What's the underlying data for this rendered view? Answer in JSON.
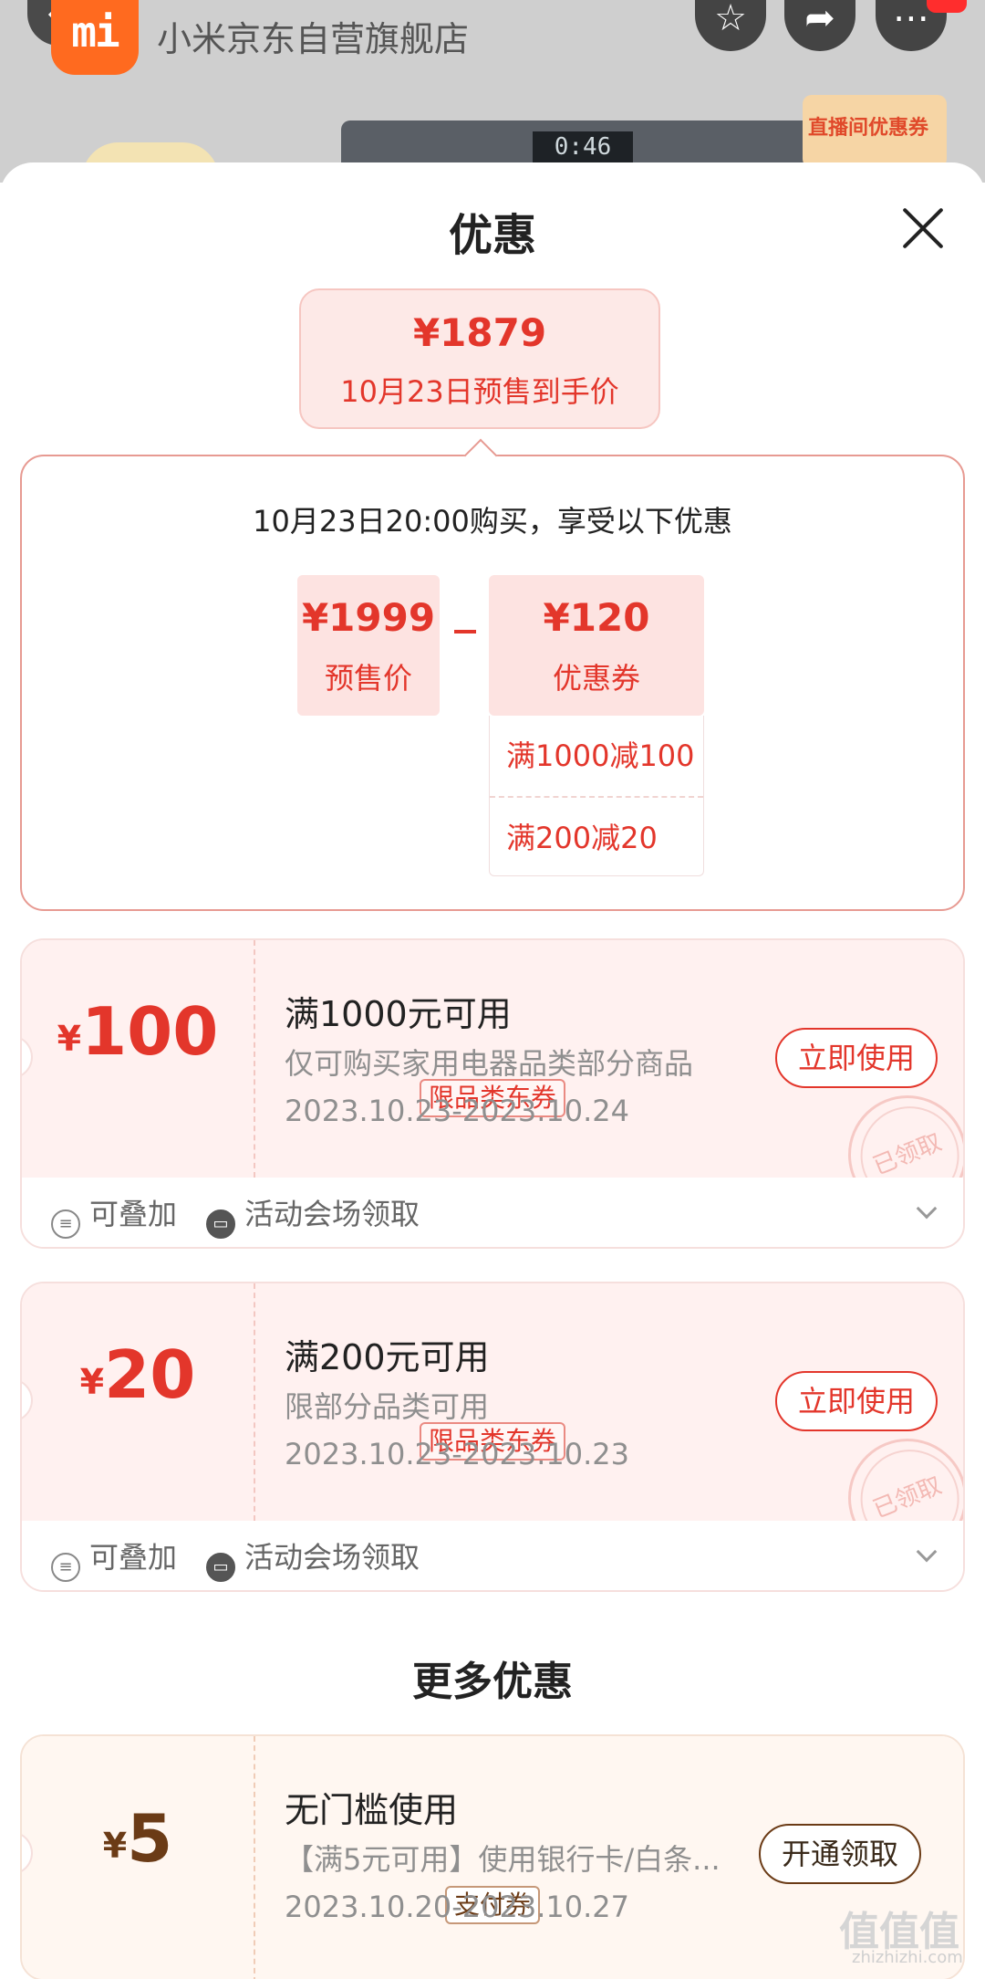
{
  "background": {
    "store_name": "小米京东自营旗舰店",
    "logo_text": "mi",
    "live_coupon_label": "直播间优惠券",
    "product_display": "0:46"
  },
  "sheet": {
    "title": "优惠",
    "final_price": {
      "price": "¥1879",
      "label": "10月23日预售到手价"
    },
    "breakdown": {
      "heading": "10月23日20:00购买，享受以下优惠",
      "presale": {
        "value": "¥1999",
        "label": "预售价"
      },
      "coupon": {
        "value": "¥120",
        "label": "优惠券"
      },
      "rules": [
        "满1000减100",
        "满200减20"
      ]
    },
    "coupons": [
      {
        "currency": "¥",
        "amount": "100",
        "tag": "限品类东券",
        "title": "满1000元可用",
        "desc": "仅可购买家用电器品类部分商品",
        "date": "2023.10.23-2023.10.24",
        "button": "立即使用",
        "stamp": "已领取",
        "stackable": "可叠加",
        "source": "活动会场领取"
      },
      {
        "currency": "¥",
        "amount": "20",
        "tag": "限品类东券",
        "title": "满200元可用",
        "desc": "限部分品类可用",
        "date": "2023.10.23-2023.10.23",
        "button": "立即使用",
        "stamp": "已领取",
        "stackable": "可叠加",
        "source": "活动会场领取"
      }
    ],
    "more": {
      "title": "更多优惠",
      "coupon": {
        "currency": "¥",
        "amount": "5",
        "tag": "支付券",
        "title": "无门槛使用",
        "desc": "【满5元可用】使用银行卡/白条...",
        "date": "2023.10.20-2023.10.27",
        "button": "开通领取"
      }
    },
    "watermark": {
      "text": "值值值",
      "site": "zhizhizhi.com"
    }
  },
  "colors": {
    "accent": "#e3362b",
    "coupon_bg": "#fff1f0",
    "pay_coupon_text": "#6b3b16"
  }
}
